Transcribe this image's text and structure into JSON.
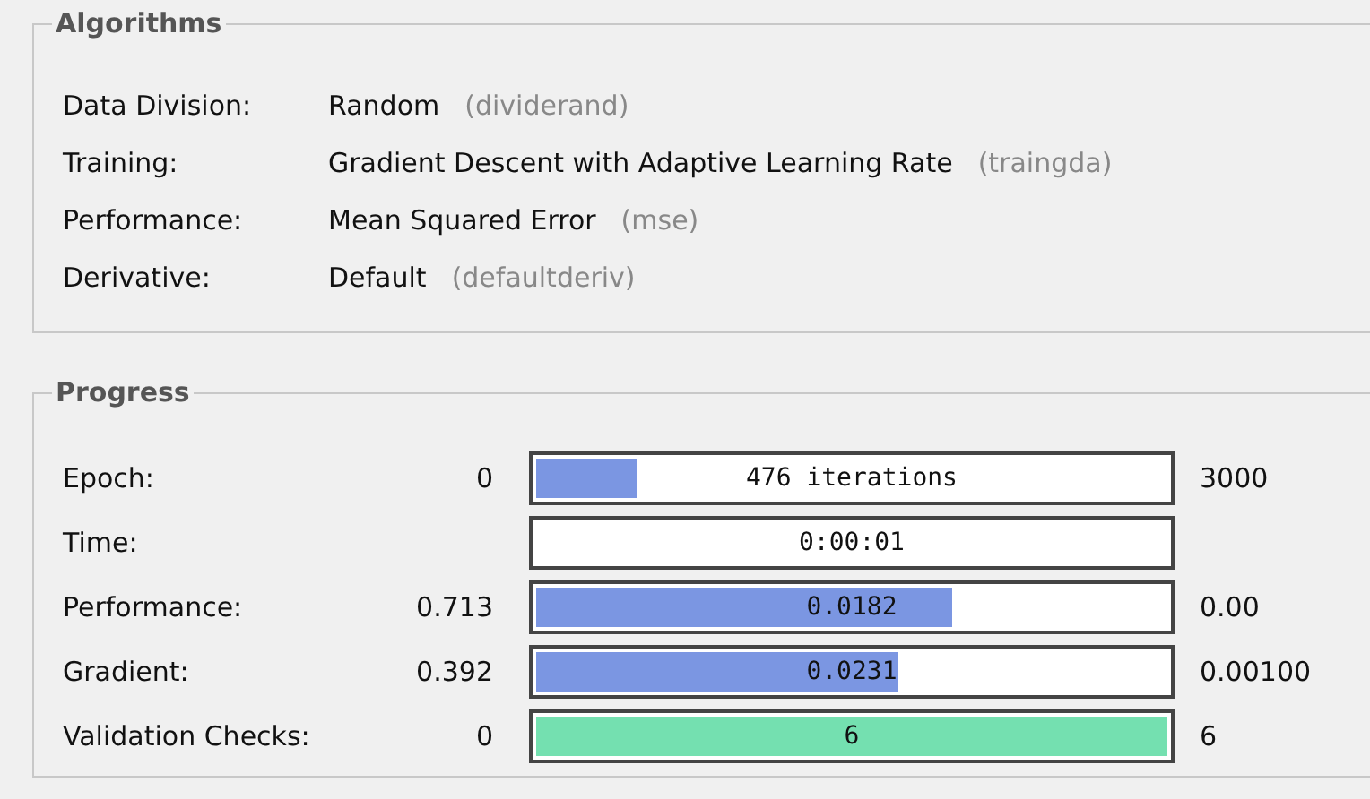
{
  "algorithms": {
    "title": "Algorithms",
    "rows": [
      {
        "label": "Data Division:",
        "value": "Random",
        "code": "(dividerand)"
      },
      {
        "label": "Training:",
        "value": "Gradient Descent with Adaptive Learning Rate",
        "code": "(traingda)"
      },
      {
        "label": "Performance:",
        "value": "Mean Squared Error",
        "code": "(mse)"
      },
      {
        "label": "Derivative:",
        "value": "Default",
        "code": "(defaultderiv)"
      }
    ]
  },
  "progress": {
    "title": "Progress",
    "rows": [
      {
        "label": "Epoch:",
        "min": "0",
        "reading": "476 iterations",
        "level": 0.16,
        "color": "#7b96e2",
        "max": "3000"
      },
      {
        "label": "Time:",
        "reading": "0:00:01"
      },
      {
        "label": "Performance:",
        "min": "0.713",
        "reading": "0.0182",
        "level": 0.66,
        "color": "#7b96e2",
        "max": "0.00"
      },
      {
        "label": "Gradient:",
        "min": "0.392",
        "reading": "0.0231",
        "level": 0.575,
        "color": "#7b96e2",
        "max": "0.00100"
      },
      {
        "label": "Validation Checks:",
        "min": "0",
        "reading": "6",
        "level": 1.0,
        "color": "#74e0b0",
        "max": "6"
      }
    ]
  }
}
